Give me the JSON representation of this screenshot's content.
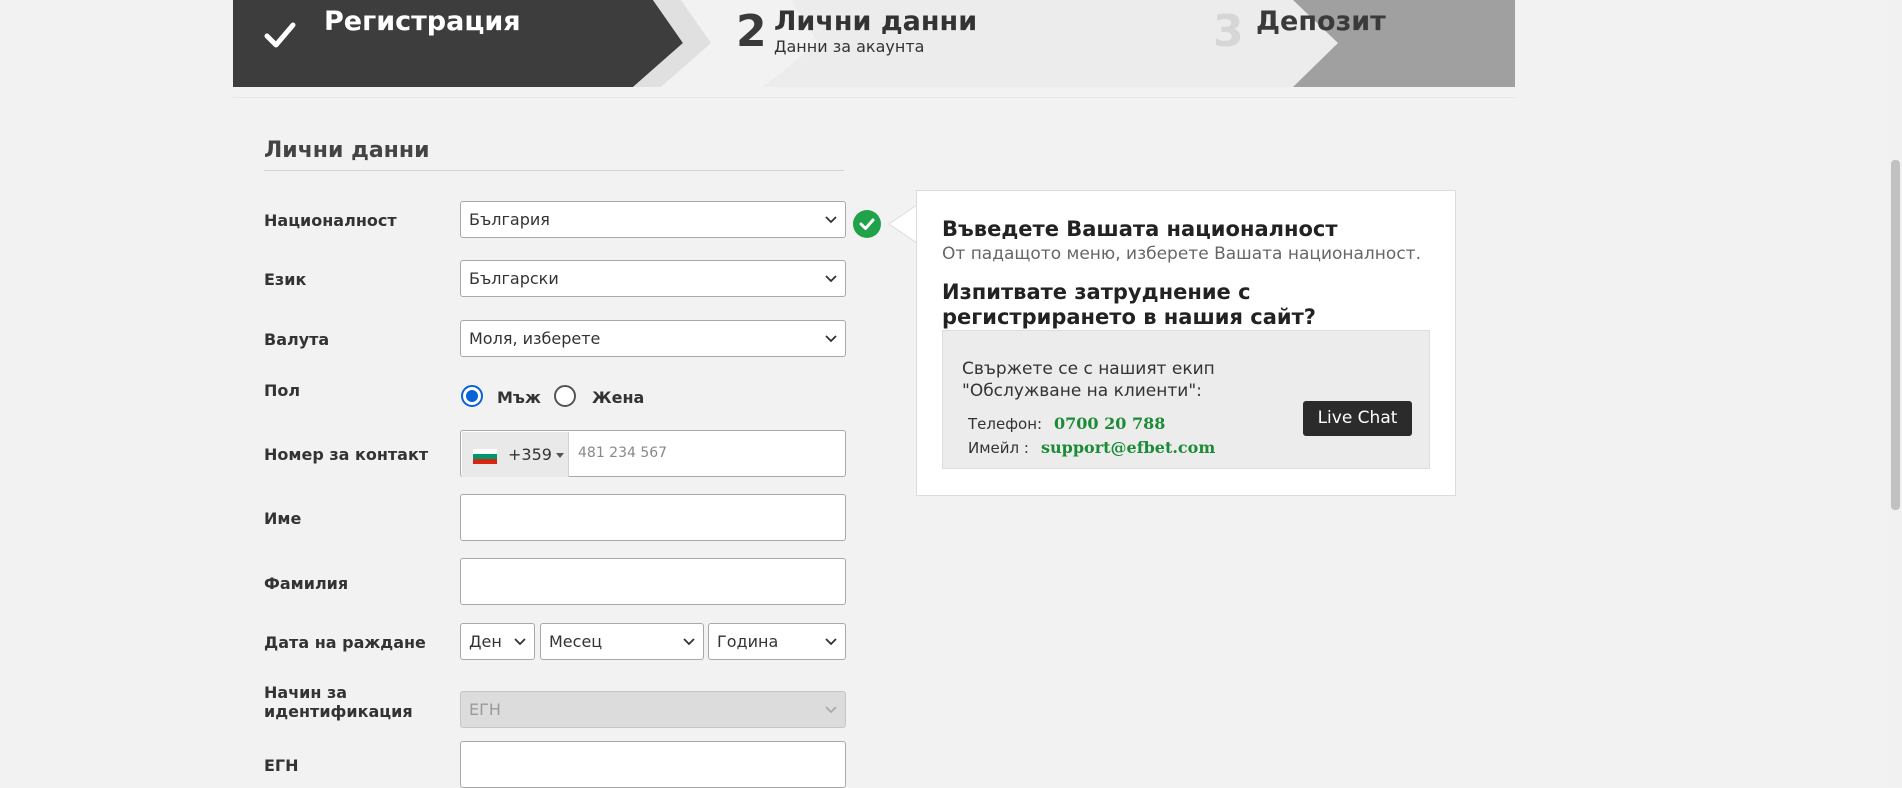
{
  "steps": [
    {
      "title": "Регистрация",
      "state": "done"
    },
    {
      "number": "2",
      "title": "Лични данни",
      "subtitle": "Данни за акаунта",
      "state": "active"
    },
    {
      "number": "3",
      "title": "Депозит",
      "state": "pending"
    }
  ],
  "form": {
    "section_title": "Лични данни",
    "nationality": {
      "label": "Националност",
      "value": "България"
    },
    "language": {
      "label": "Език",
      "value": "Български"
    },
    "currency": {
      "label": "Валута",
      "value": "Моля, изберете"
    },
    "gender": {
      "label": "Пол",
      "options": [
        "Мъж",
        "Жена"
      ],
      "selected": "Мъж"
    },
    "phone": {
      "label": "Номер за контакт",
      "code": "+359",
      "placeholder": "481 234 567"
    },
    "first_name": {
      "label": "Име",
      "value": ""
    },
    "last_name": {
      "label": "Фамилия",
      "value": ""
    },
    "birth_date": {
      "label": "Дата на раждане",
      "day": "Ден",
      "month": "Месец",
      "year": "Година"
    },
    "id_method": {
      "label_line1": "Начин за",
      "label_line2": "идентификация",
      "value": "ЕГН"
    },
    "egn": {
      "label": "ЕГН",
      "value": ""
    }
  },
  "info": {
    "title": "Въведете Вашата националност",
    "text": "От падащото меню, изберете Вашата националност.",
    "help_title": "Изпитвате затруднение с регистрирането в нашия сайт?",
    "contact_text_1": "Свържете се с нашият екип",
    "contact_text_2": "\"Обслужване на клиенти\":",
    "phone_label": "Телефон:",
    "phone_value": "0700 20 788",
    "email_label": "Имейл :",
    "email_value": "support@efbet.com",
    "live_chat": "Live Chat"
  },
  "colors": {
    "step_done": "#3d3d3d",
    "step_active": "#ececec",
    "step_pending": "#a0a0a0",
    "success": "#1fa24a",
    "link_green": "#1b8c35",
    "radio_blue": "#0a62d6"
  }
}
